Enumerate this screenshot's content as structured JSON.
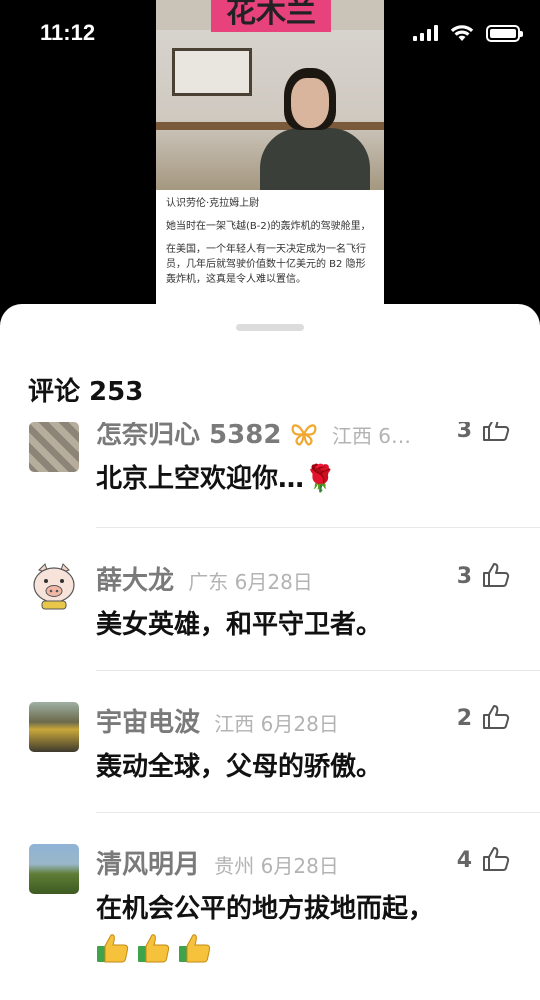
{
  "status_bar": {
    "time": "11:12"
  },
  "video": {
    "title": "花木兰",
    "caption_heading": "认识劳伦·克拉姆上尉",
    "caption_line1": "她当时在一架飞越(B-2)的轰炸机的驾驶舱里，",
    "caption_line2": "在美国，一个年轻人有一天决定成为一名飞行员，几年后就驾驶价值数十亿美元的 B2 隐形轰炸机，这真是令人难以置信。"
  },
  "comments": {
    "header": "评论 253",
    "items": [
      {
        "user": "怎奈归心 5382",
        "region": "江西 6…",
        "likes": "3",
        "text": "北京上空欢迎你…🌹"
      },
      {
        "user": "薛大龙",
        "region": "广东 6月28日",
        "likes": "3",
        "text": "美女英雄，和平守卫者。"
      },
      {
        "user": "宇宙电波",
        "region": "江西 6月28日",
        "likes": "2",
        "text": "轰动全球，父母的骄傲。"
      },
      {
        "user": "清风明月",
        "region": "贵州 6月28日",
        "likes": "4",
        "text": "在机会公平的地方拔地而起，"
      }
    ]
  },
  "colors": {
    "accent_butterfly": "#f0a830",
    "rose": "#d8342f"
  }
}
